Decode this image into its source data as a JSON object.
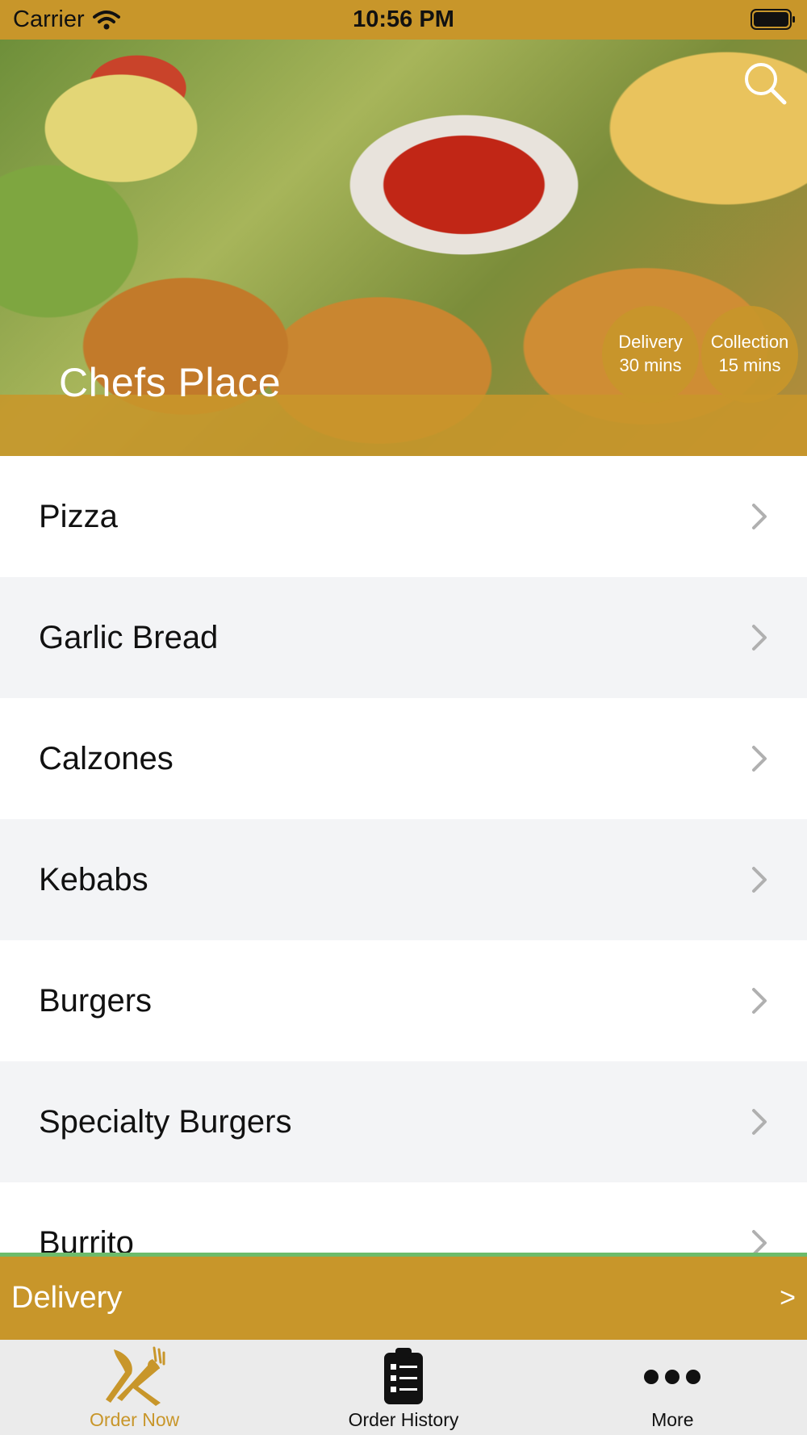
{
  "status_bar": {
    "carrier": "Carrier",
    "time": "10:56 PM"
  },
  "hero": {
    "store_name": "Chefs Place",
    "delivery": {
      "label": "Delivery",
      "time": "30 mins"
    },
    "collection": {
      "label": "Collection",
      "time": "15 mins"
    }
  },
  "categories": [
    "Pizza",
    "Garlic Bread",
    "Calzones",
    "Kebabs",
    "Burgers",
    "Specialty Burgers",
    "Burrito"
  ],
  "delivery_bar": {
    "label": "Delivery",
    "arrow": ">"
  },
  "tabs": [
    {
      "label": "Order Now",
      "icon": "fork-knife-icon",
      "active": true
    },
    {
      "label": "Order History",
      "icon": "clipboard-icon",
      "active": false
    },
    {
      "label": "More",
      "icon": "more-dots-icon",
      "active": false
    }
  ],
  "colors": {
    "accent": "#c8962a",
    "row_alt": "#f3f4f6",
    "delivery_border": "#6dbb6a"
  }
}
